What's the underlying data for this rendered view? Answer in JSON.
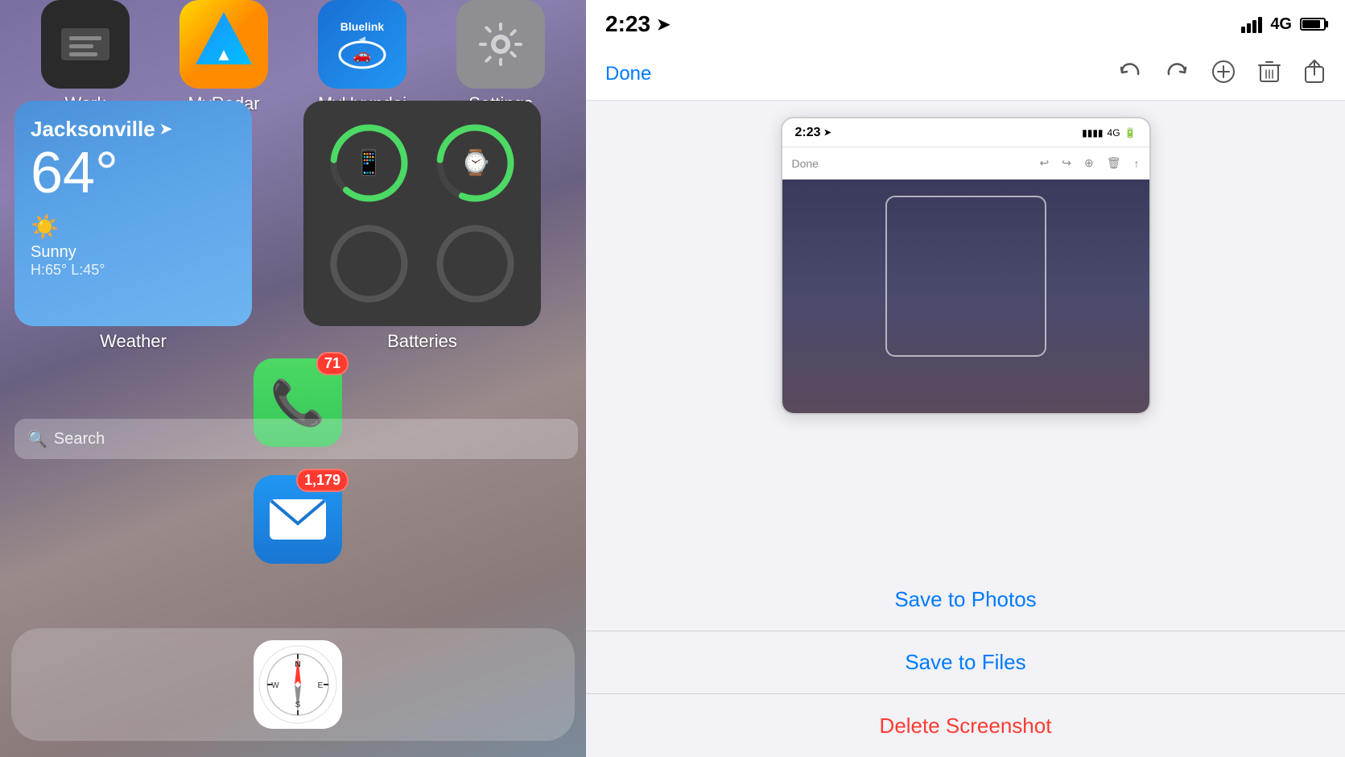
{
  "leftPanel": {
    "background": "gradient",
    "topApps": [
      {
        "label": "Work",
        "iconType": "work"
      },
      {
        "label": "MyRadar",
        "iconType": "myradar"
      },
      {
        "label": "MyHyundai",
        "iconType": "bluelink"
      },
      {
        "label": "Settings",
        "iconType": "settings"
      }
    ],
    "weatherWidget": {
      "city": "Jacksonville",
      "temp": "64°",
      "condition": "Sunny",
      "hilo": "H:65°  L:45°",
      "label": "Weather",
      "navArrow": "➤"
    },
    "batteriesWidget": {
      "label": "Batteries",
      "items": [
        {
          "type": "phone",
          "percent": 85,
          "icon": "📱"
        },
        {
          "type": "watch",
          "percent": 80,
          "icon": "⌚"
        },
        {
          "type": "empty1",
          "percent": 0,
          "icon": ""
        },
        {
          "type": "empty2",
          "percent": 0,
          "icon": ""
        }
      ]
    },
    "phoneApp": {
      "badge": "71",
      "icon": "📞"
    },
    "searchBar": {
      "text": "Search"
    },
    "mailApp": {
      "badge": "1,179",
      "icon": "✉️"
    },
    "safariApp": {
      "label": ""
    }
  },
  "rightPanel": {
    "statusBar": {
      "time": "2:23",
      "navArrow": "➤",
      "signal": "4G",
      "signalBars": 4
    },
    "toolbar": {
      "done": "Done",
      "icons": [
        "undo",
        "redo",
        "draw",
        "delete",
        "share"
      ]
    },
    "preview": {
      "statusBar": {
        "time": "2:23",
        "navArrow": "➤",
        "signal": "4G"
      },
      "toolbar": {
        "done": "Done"
      }
    },
    "actionSheet": {
      "items": [
        {
          "label": "Save to Photos",
          "color": "#007aff",
          "type": "save-photos"
        },
        {
          "label": "Save to Files",
          "color": "#007aff",
          "type": "save-files"
        },
        {
          "label": "Delete Screenshot",
          "color": "#ff3b30",
          "type": "delete"
        }
      ]
    }
  }
}
